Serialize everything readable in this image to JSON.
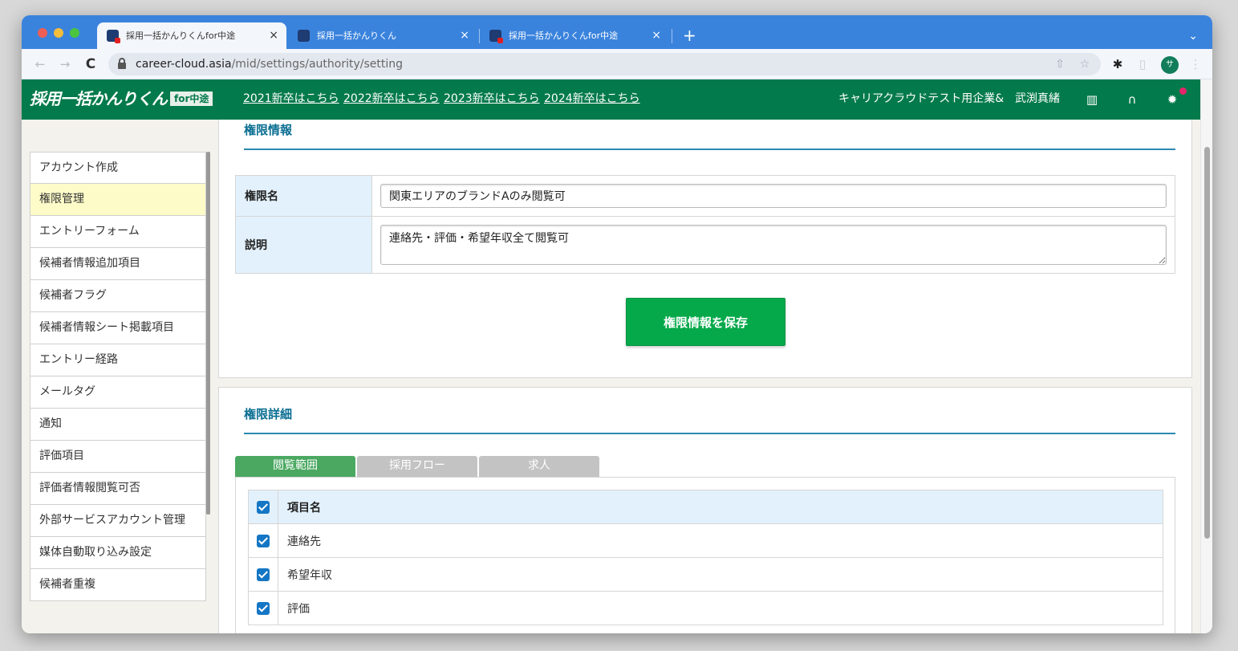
{
  "browser": {
    "tabs": [
      {
        "title": "採用一括かんりくんfor中途",
        "active": true
      },
      {
        "title": "採用一括かんりくん",
        "active": false
      },
      {
        "title": "採用一括かんりくんfor中途",
        "active": false
      }
    ],
    "new_tab": "+",
    "tab_menu": "⌄",
    "url_host": "career-cloud.asia",
    "url_path": "/mid/settings/authority/setting",
    "profile_initial": "サ",
    "icons": {
      "back": "←",
      "forward": "→",
      "reload": "C",
      "share": "⇧",
      "star": "☆",
      "extensions": "✱",
      "sidepanel": "▯",
      "menu": "⋮",
      "close": "×"
    }
  },
  "header": {
    "logo_main": "採用一括かんりくん",
    "logo_tag": "for中途",
    "links": [
      "2021新卒はこちら",
      "2022新卒はこちら",
      "2023新卒はこちら",
      "2024新卒はこちら"
    ],
    "company": "キャリアクラウドテスト用企業&",
    "user": "武渕真緒",
    "icons": {
      "manual": "▥",
      "support": "∩",
      "settings": "✹"
    }
  },
  "sidebar": {
    "items": [
      {
        "label": "アカウント作成",
        "active": false
      },
      {
        "label": "権限管理",
        "active": true
      },
      {
        "label": "エントリーフォーム",
        "active": false
      },
      {
        "label": "候補者情報追加項目",
        "active": false
      },
      {
        "label": "候補者フラグ",
        "active": false
      },
      {
        "label": "候補者情報シート掲載項目",
        "active": false
      },
      {
        "label": "エントリー経路",
        "active": false
      },
      {
        "label": "メールタグ",
        "active": false
      },
      {
        "label": "通知",
        "active": false
      },
      {
        "label": "評価項目",
        "active": false
      },
      {
        "label": "評価者情報閲覧可否",
        "active": false
      },
      {
        "label": "外部サービスアカウント管理",
        "active": false
      },
      {
        "label": "媒体自動取り込み設定",
        "active": false
      },
      {
        "label": "候補者重複",
        "active": false
      }
    ]
  },
  "authority_info": {
    "title": "権限情報",
    "name_label": "権限名",
    "name_value": "関東エリアのブランドAのみ閲覧可",
    "description_label": "説明",
    "description_value": "連絡先・評価・希望年収全て閲覧可",
    "save_button": "権限情報を保存"
  },
  "authority_detail": {
    "title": "権限詳細",
    "tabs": [
      {
        "label": "閲覧範囲",
        "active": true
      },
      {
        "label": "採用フロー",
        "active": false
      },
      {
        "label": "求人",
        "active": false
      }
    ],
    "column_header": "項目名",
    "rows": [
      {
        "label": "連絡先",
        "checked": true
      },
      {
        "label": "希望年収",
        "checked": true
      },
      {
        "label": "評価",
        "checked": true
      }
    ]
  },
  "colors": {
    "tabstrip": "#3a83dd",
    "header_green": "#037a4b",
    "save_button": "#06a94a",
    "active_tab": "#4aa861",
    "section_title": "#0a6e92",
    "sidebar_active": "#fdfbc8"
  }
}
